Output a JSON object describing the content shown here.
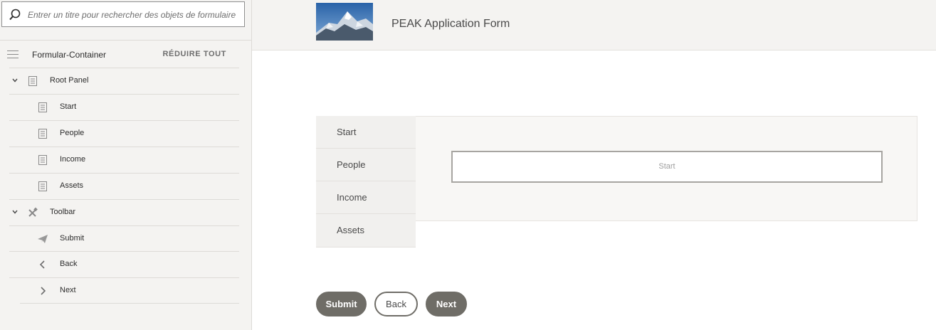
{
  "sidebar": {
    "search_placeholder": "Entrer un titre pour rechercher des objets de formulaire",
    "header_title": "Formular-Container",
    "collapse_all": "RÉDUIRE TOUT",
    "items": [
      {
        "label": "Root Panel",
        "icon": "panel-icon",
        "expandable": true
      },
      {
        "label": "Start",
        "icon": "panel-icon"
      },
      {
        "label": "People",
        "icon": "panel-icon"
      },
      {
        "label": "Income",
        "icon": "panel-icon"
      },
      {
        "label": "Assets",
        "icon": "panel-icon"
      },
      {
        "label": "Toolbar",
        "icon": "tools-icon",
        "expandable": true
      },
      {
        "label": "Submit",
        "icon": "paper-plane-icon"
      },
      {
        "label": "Back",
        "icon": "chevron-left-icon"
      },
      {
        "label": "Next",
        "icon": "chevron-right-icon"
      }
    ]
  },
  "form": {
    "title": "PEAK Application Form",
    "tabs": [
      "Start",
      "People",
      "Income",
      "Assets"
    ],
    "active_panel_label": "Start",
    "buttons": {
      "submit": "Submit",
      "back": "Back",
      "next": "Next"
    }
  },
  "colors": {
    "button_dark": "#6f6d67",
    "sidebar_bg": "#f4f3f1"
  }
}
